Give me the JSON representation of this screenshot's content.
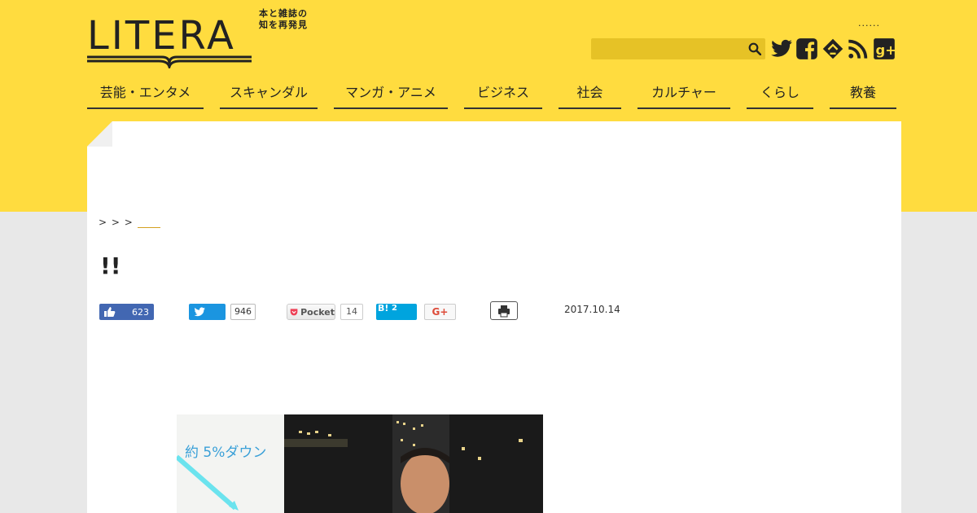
{
  "header": {
    "logo_text": "LITERA",
    "tagline": "本と雑誌の知を再発見",
    "dots": "......",
    "search_placeholder": "",
    "social": [
      "twitter-icon",
      "facebook-icon",
      "feedly-icon",
      "rss-icon",
      "google-plus-icon"
    ]
  },
  "nav": {
    "items": [
      {
        "label": "芸能・エンタメ"
      },
      {
        "label": "スキャンダル"
      },
      {
        "label": "マンガ・アニメ"
      },
      {
        "label": "ビジネス"
      },
      {
        "label": "社会"
      },
      {
        "label": "カルチャー"
      },
      {
        "label": "くらし"
      },
      {
        "label": "教養"
      }
    ]
  },
  "breadcrumb": {
    "sep1": "> ",
    "sep2": "> ",
    "sep3": "> "
  },
  "article": {
    "title": "!!",
    "date": "2017.10.14"
  },
  "share": {
    "facebook_count": "623",
    "twitter_count": "946",
    "pocket_label": "Pocket",
    "pocket_count": "14",
    "hatena_label": "B!",
    "hatena_count": "2",
    "gplus_label": "G+"
  },
  "photo": {
    "panel_text": "約 5%ダウン"
  },
  "colors": {
    "brand_yellow": "#ffdc3f",
    "facebook": "#4267b2",
    "twitter": "#1b95e0",
    "hatena": "#00a4de"
  }
}
